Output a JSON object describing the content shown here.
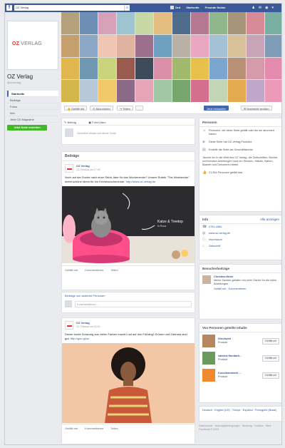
{
  "topbar": {
    "logo": "f",
    "search_value": "OZ Verlag",
    "search_icon": "search-icon",
    "nav_profile": "Ord",
    "nav_home": "Startseite",
    "nav_friends": "Freunde finden",
    "nav_icons": [
      "friend-requests-icon",
      "messages-icon",
      "notifications-icon",
      "settings-icon"
    ]
  },
  "page": {
    "logo_oz": "OZ",
    "logo_verlag": "VERLAG",
    "name": "OZ Verlag",
    "handle": "@ozverlag"
  },
  "sidebar": {
    "items": [
      {
        "label": "Startseite",
        "active": true
      },
      {
        "label": "Beiträge"
      },
      {
        "label": "Fotos"
      },
      {
        "label": "Info"
      },
      {
        "label": "Jetzt OZ-Magazine"
      }
    ],
    "cta": "Jetzt Seite erstellen"
  },
  "action_bar": {
    "like": "Gefällt mir",
    "follow": "Abonnieren",
    "share": "Teilen",
    "more": "...",
    "send_message": "Jetzt einkaufen",
    "message": "Nachricht senden"
  },
  "composer": {
    "tab_post": "Beitrag",
    "tab_photo": "Foto/Video",
    "placeholder": "Schreibe etwas auf diese Seite"
  },
  "feed": {
    "section": "Beiträge",
    "post1": {
      "author": "OZ Verlag",
      "time": "13. Februar um 17:00",
      "text": "Noch auf der Suche nach einer Strick-Idee für das Wochenende? Unsere Rubrik \"The Weekender\" bietet schöne Ideen für ein Kreativwochenende.",
      "link": "http://www.oz-verlag.de",
      "image_caption": "Katze & Treetop",
      "image_sub": "In Rosa",
      "actions": [
        "Gefällt mir",
        "Kommentieren",
        "Teilen"
      ],
      "comment_placeholder": "Kommentieren ..."
    },
    "post2": {
      "author": "OZ Verlag",
      "time": "13. Februar um 11:00",
      "text": "Dieser bunte Schwung aus vielen Farben macht Lust auf den Frühling! Grünen und Zartrosa sind gut.",
      "link": "http://goo.gl/oz",
      "actions": [
        "Gefällt mir",
        "Kommentieren",
        "Teilen"
      ]
    },
    "shared_label": "Beiträge von anderen Personen"
  },
  "right": {
    "about_title": "Personen",
    "about_rows": [
      "Personen, die diese Seite gefällt oder die sie abonniert haben",
      "Diese Seite hat OZ-Verlag-Produkte",
      "Erstelle die Seite als Geschäftskonto"
    ],
    "description": "Tauche ein in die Welt des OZ Verlag, die Zeitschriften, Bücher und kreative Anleitungen rund um Stricken, Häkeln, Nähen, Basteln und Dekorieren bietet.",
    "likes_count": "21.354 Personen gefällt das",
    "info_title": "Info",
    "info_link": "Alle anzeigen",
    "info_rows": [
      {
        "icon": "phone-icon",
        "text": "0761-4464"
      },
      {
        "icon": "web-icon",
        "text": "www.oz-verlag.de"
      },
      {
        "icon": "info-icon",
        "text": "Impressum"
      },
      {
        "icon": "category-icon",
        "text": "Zeitschrift"
      }
    ],
    "visitor_title": "Besucherbeiträge",
    "visitor_name": "Christina Meier",
    "visitor_text": "Meine Sachen gefallen mir sehr! Danke für die tollen Anleitungen.",
    "visitor_meta": "Gefällt mir · Kommentieren",
    "liked_title": "Von Personen geteilte Inhalte",
    "liked_pages": [
      {
        "name": "Strickwelt",
        "cat": "Produkt"
      },
      {
        "name": "sabrina Handarb...",
        "cat": "Produkt"
      },
      {
        "name": "Kunsthandwerk ...",
        "cat": "Produkt"
      }
    ],
    "like_btn": "Gefällt mir",
    "language_title": "Deutsch · English (US) · Türkçe · Español · Português (Brasil)",
    "footer": "Datenschutz · Nutzungsbedingungen · Werbung · Cookies · Mehr · Facebook © 2015"
  }
}
